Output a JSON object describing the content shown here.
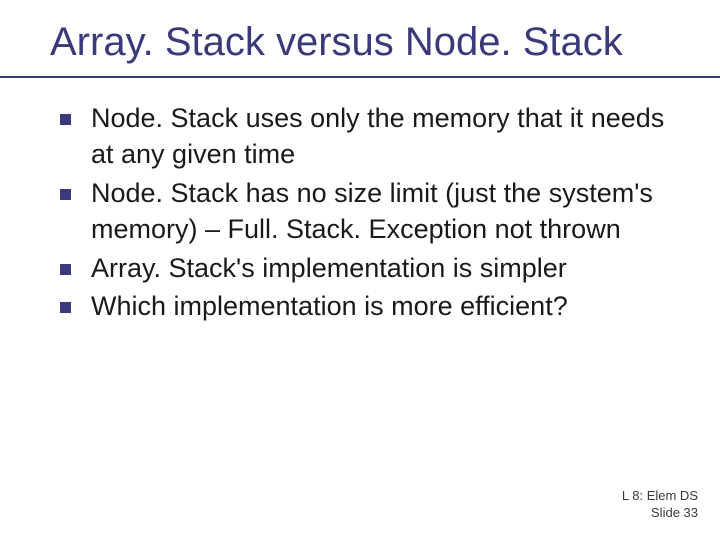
{
  "title": "Array. Stack versus Node. Stack",
  "bullets": [
    "Node. Stack uses only the memory that it needs at any given time",
    "Node. Stack has no size limit (just the system's memory) – Full. Stack. Exception not thrown",
    "Array. Stack's implementation is simpler",
    "Which implementation is more efficient?"
  ],
  "footer": {
    "line1": "L 8: Elem DS",
    "line2": "Slide 33"
  }
}
